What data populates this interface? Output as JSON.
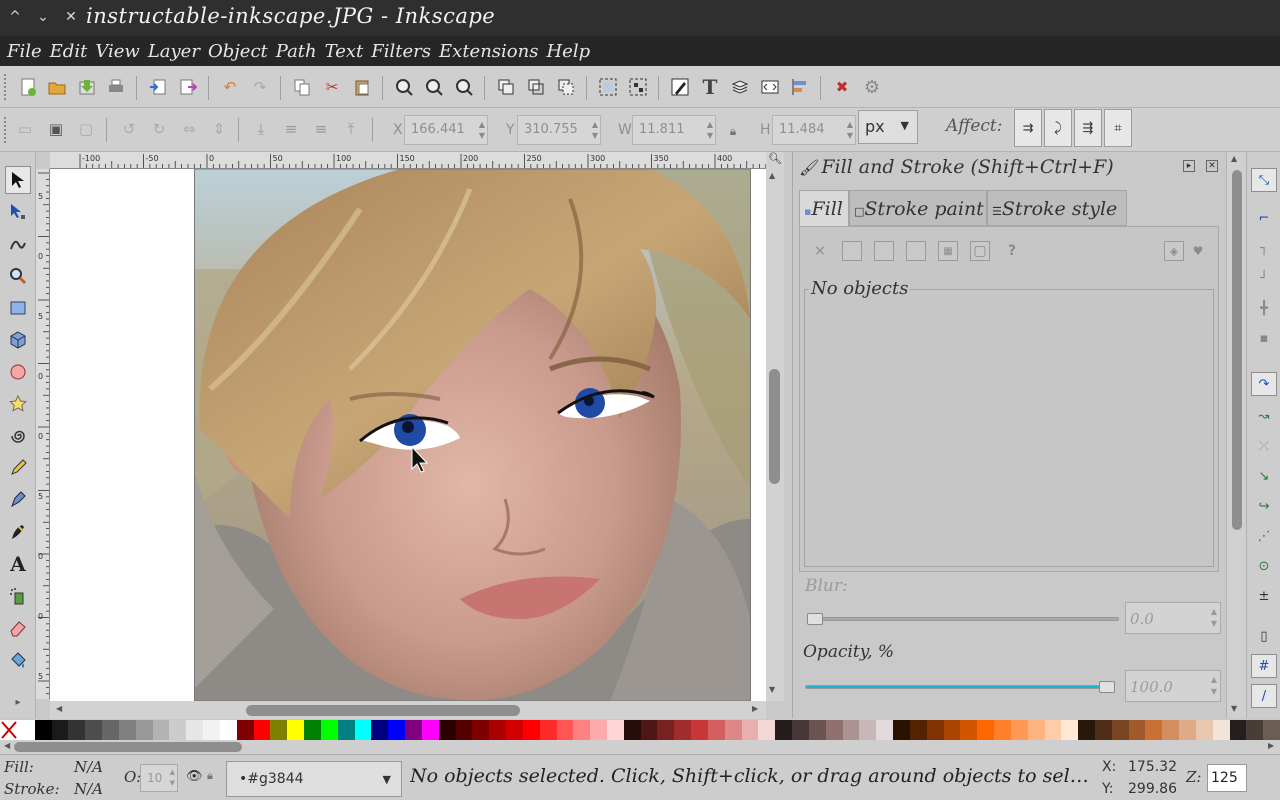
{
  "window": {
    "title": "instructable-inkscape.JPG - Inkscape",
    "controls": [
      "^",
      "⌄",
      "✕"
    ]
  },
  "menu": [
    "File",
    "Edit",
    "View",
    "Layer",
    "Object",
    "Path",
    "Text",
    "Filters",
    "Extensions",
    "Help"
  ],
  "commands_toolbar": {
    "icons": [
      "new-document-icon",
      "open-icon",
      "save-icon",
      "print-icon",
      "import-icon",
      "export-icon",
      "undo-icon",
      "redo-icon",
      "copy-icon",
      "cut-icon",
      "paste-icon",
      "zoom-selection-icon",
      "zoom-drawing-icon",
      "zoom-page-icon",
      "duplicate-icon",
      "clone-icon",
      "unlink-clone-icon",
      "group-icon",
      "ungroup-icon",
      "fill-stroke-icon",
      "text-font-icon",
      "layers-icon",
      "xml-editor-icon",
      "align-distribute-icon",
      "preferences-icon",
      "document-properties-icon"
    ]
  },
  "tool_controls": {
    "x_label": "X",
    "x_value": "166.441",
    "y_label": "Y",
    "y_value": "310.755",
    "w_label": "W",
    "w_value": "11.811",
    "h_label": "H",
    "h_value": "11.484",
    "unit": "px",
    "affect_label": "Affect:"
  },
  "ruler": {
    "horizontal_ticks": [
      "-100",
      "-50",
      "0",
      "50",
      "100",
      "150",
      "200",
      "250",
      "300",
      "350",
      "400"
    ],
    "vertical_ticks": [
      "5",
      "0",
      "5",
      "0",
      "0",
      "5",
      "0",
      "0",
      "5"
    ]
  },
  "tools": [
    "selector-tool-icon",
    "node-tool-icon",
    "tweak-tool-icon",
    "zoom-tool-icon",
    "rectangle-tool-icon",
    "3d-box-tool-icon",
    "ellipse-tool-icon",
    "star-tool-icon",
    "spiral-tool-icon",
    "pencil-tool-icon",
    "pen-tool-icon",
    "calligraphy-tool-icon",
    "text-tool-icon",
    "spray-tool-icon",
    "eraser-tool-icon",
    "paint-bucket-tool-icon"
  ],
  "fill_stroke_dialog": {
    "title": "Fill and Stroke (Shift+Ctrl+F)",
    "tabs": [
      "Fill",
      "Stroke paint",
      "Stroke style"
    ],
    "paint_buttons": [
      "×",
      "",
      "",
      "",
      "",
      "",
      "?"
    ],
    "no_objects_label": "No objects",
    "blur_label": "Blur:",
    "blur_value": "0.0",
    "opacity_label": "Opacity, %",
    "opacity_value": "100.0",
    "opacity_fraction": 1.0,
    "blur_fraction": 0.0
  },
  "palette": [
    "#ffffff",
    "#000000",
    "#1a1a1a",
    "#333333",
    "#4d4d4d",
    "#666666",
    "#808080",
    "#999999",
    "#b3b3b3",
    "#cccccc",
    "#e6e6e6",
    "#f2f2f2",
    "#ffffff",
    "#800000",
    "#ff0000",
    "#808000",
    "#ffff00",
    "#008000",
    "#00ff00",
    "#008080",
    "#00ffff",
    "#000080",
    "#0000ff",
    "#800080",
    "#ff00ff",
    "#2b0000",
    "#550000",
    "#800000",
    "#aa0000",
    "#d40000",
    "#ff0000",
    "#ff2a2a",
    "#ff5555",
    "#ff8080",
    "#ffaaaa",
    "#ffd5d5",
    "#280b0b",
    "#501616",
    "#782121",
    "#a02c2c",
    "#c83737",
    "#d35f5f",
    "#de8787",
    "#e9afaf",
    "#f4d7d7",
    "#241c1c",
    "#483737",
    "#6c5353",
    "#916f6f",
    "#ac9393",
    "#c8b7b7",
    "#e3dbdb",
    "#2b1100",
    "#552200",
    "#803300",
    "#aa4400",
    "#d45500",
    "#ff6600",
    "#ff7f2a",
    "#ff9955",
    "#ffb380",
    "#ffccaa",
    "#ffe6d5",
    "#28170b",
    "#502d16",
    "#784421",
    "#a05a2c",
    "#c87137",
    "#d38d5f",
    "#deaa87",
    "#e9c6af",
    "#f4e3d7",
    "#241f1c",
    "#483e37",
    "#6c5d53"
  ],
  "status": {
    "fill_label": "Fill:",
    "fill_value": "N/A",
    "stroke_label": "Stroke:",
    "stroke_value": "N/A",
    "opacity_label": "O:",
    "opacity_value": "10",
    "layer_name": "•#g3844",
    "message": "No objects selected. Click, Shift+click, or drag around objects to sel…",
    "x_label": "X:",
    "x_value": "175.32",
    "y_label": "Y:",
    "y_value": "299.86",
    "zoom_label": "Z:",
    "zoom_value": "125"
  }
}
